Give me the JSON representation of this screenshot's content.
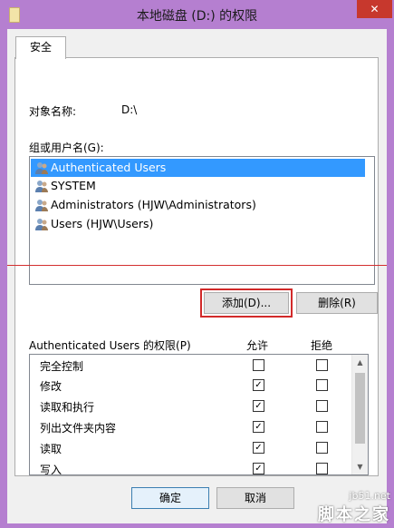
{
  "window": {
    "title": "本地磁盘 (D:) 的权限",
    "close_glyph": "✕"
  },
  "tab": {
    "label": "安全"
  },
  "object": {
    "label": "对象名称:",
    "value": "D:\\"
  },
  "group": {
    "label": "组或用户名(G):",
    "users": [
      {
        "name": "Authenticated Users",
        "selected": true
      },
      {
        "name": "SYSTEM",
        "selected": false
      },
      {
        "name": "Administrators (HJW\\Administrators)",
        "selected": false
      },
      {
        "name": "Users (HJW\\Users)",
        "selected": false
      }
    ]
  },
  "buttons": {
    "add": "添加(D)...",
    "remove": "删除(R)",
    "ok": "确定",
    "cancel": "取消"
  },
  "permissions": {
    "label": "Authenticated Users 的权限(P)",
    "allow_header": "允许",
    "deny_header": "拒绝",
    "rows": [
      {
        "name": "完全控制",
        "allow": false,
        "deny": false
      },
      {
        "name": "修改",
        "allow": true,
        "deny": false
      },
      {
        "name": "读取和执行",
        "allow": true,
        "deny": false
      },
      {
        "name": "列出文件夹内容",
        "allow": true,
        "deny": false
      },
      {
        "name": "读取",
        "allow": true,
        "deny": false
      },
      {
        "name": "写入",
        "allow": true,
        "deny": false
      }
    ]
  },
  "watermark": {
    "url": "jb51.net",
    "name": "脚本之家"
  },
  "colors": {
    "selection": "#3399ff",
    "highlight_box": "#d22a2a",
    "frame": "#b57fd0"
  }
}
